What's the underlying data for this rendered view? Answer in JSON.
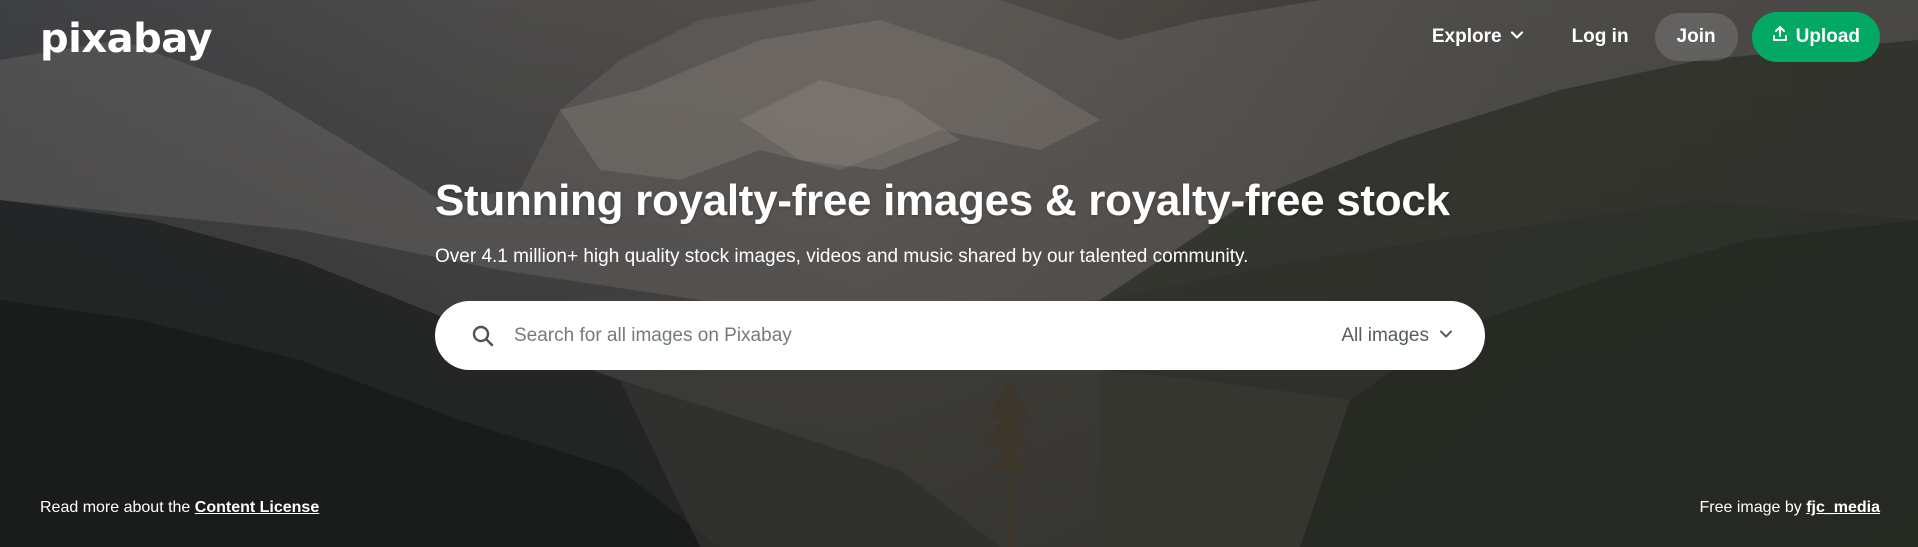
{
  "header": {
    "logo": "pixabay",
    "nav": {
      "explore_label": "Explore",
      "login_label": "Log in",
      "join_label": "Join",
      "upload_label": "Upload"
    }
  },
  "hero": {
    "title": "Stunning royalty-free images & royalty-free stock",
    "subtitle": "Over 4.1 million+ high quality stock images, videos and music shared by our talented community.",
    "search": {
      "placeholder": "Search for all images on Pixabay",
      "scope_label": "All images"
    }
  },
  "footer": {
    "license_prefix": "Read more about the ",
    "license_link": "Content License",
    "credit_prefix": "Free image by ",
    "credit_author": "fjc_media"
  },
  "colors": {
    "upload_green": "#02a863",
    "search_bg": "#ffffff",
    "text": "#ffffff"
  },
  "icons": {
    "explore": "chevron-down-icon",
    "upload": "upload-icon",
    "search": "search-icon",
    "scope": "chevron-down-icon"
  }
}
